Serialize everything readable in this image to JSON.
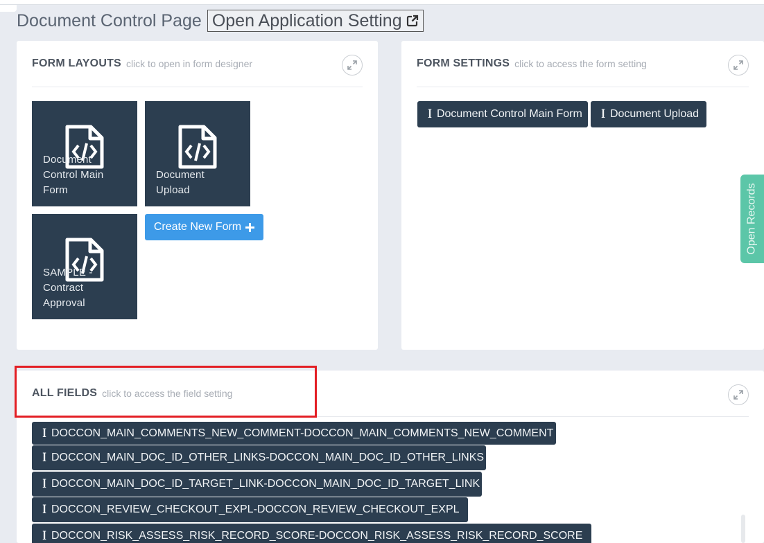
{
  "page_title": "Document Control Page",
  "app_setting_label": "Open Application Setting",
  "form_layouts": {
    "title": "FORM LAYOUTS",
    "subtitle": "click to open in form designer",
    "tiles": [
      {
        "label": "Document Control Main Form"
      },
      {
        "label": "Document Upload"
      },
      {
        "label": "SAMPLE - Contract Approval"
      }
    ],
    "create_label": "Create New Form"
  },
  "form_settings": {
    "title": "FORM SETTINGS",
    "subtitle": "click to access the form setting",
    "buttons": [
      {
        "label": "Document Control Main Form"
      },
      {
        "label": "Document Upload"
      }
    ]
  },
  "all_fields": {
    "title": "ALL FIELDS",
    "subtitle": "click to access the field setting",
    "fields": [
      "DOCCON_MAIN_COMMENTS_NEW_COMMENT-DOCCON_MAIN_COMMENTS_NEW_COMMENT",
      "DOCCON_MAIN_DOC_ID_OTHER_LINKS-DOCCON_MAIN_DOC_ID_OTHER_LINKS",
      "DOCCON_MAIN_DOC_ID_TARGET_LINK-DOCCON_MAIN_DOC_ID_TARGET_LINK",
      "DOCCON_REVIEW_CHECKOUT_EXPL-DOCCON_REVIEW_CHECKOUT_EXPL",
      "DOCCON_RISK_ASSESS_RISK_RECORD_SCORE-DOCCON_RISK_ASSESS_RISK_RECORD_SCORE"
    ]
  },
  "side_tab_label": "Open Records",
  "icons": {
    "external_link": "external-link-icon",
    "expand": "expand-icon",
    "file_code": "file-code-icon",
    "plus": "plus-icon",
    "text_cursor": "text-cursor-icon"
  },
  "colors": {
    "tile_bg": "#2c3e50",
    "create_btn": "#3d9ae8",
    "side_tab": "#5cc6a8",
    "highlight": "#e31e24",
    "page_bg": "#e8ebf1"
  }
}
